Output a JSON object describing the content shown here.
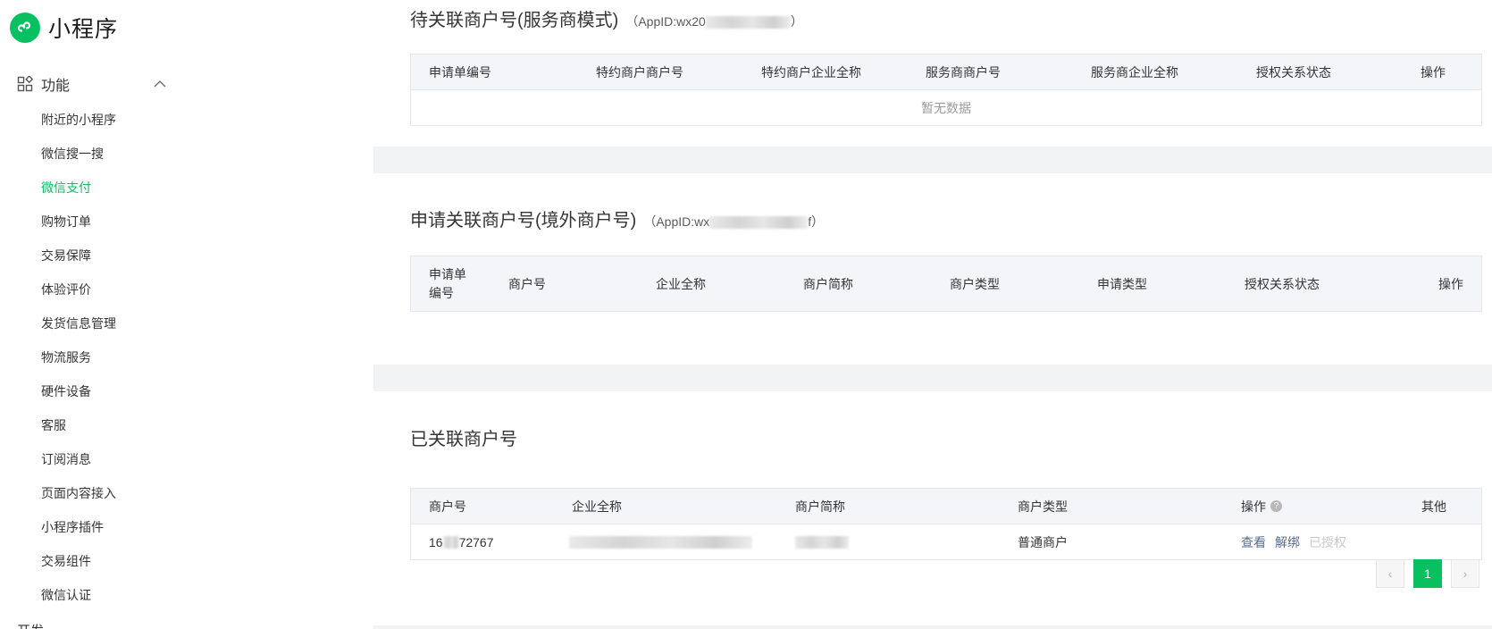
{
  "app": {
    "title": "小程序"
  },
  "nav": {
    "group_label": "功能",
    "items": [
      {
        "label": "附近的小程序",
        "active": false
      },
      {
        "label": "微信搜一搜",
        "active": false
      },
      {
        "label": "微信支付",
        "active": true
      },
      {
        "label": "购物订单",
        "active": false
      },
      {
        "label": "交易保障",
        "active": false
      },
      {
        "label": "体验评价",
        "active": false
      },
      {
        "label": "发货信息管理",
        "active": false
      },
      {
        "label": "物流服务",
        "active": false
      },
      {
        "label": "硬件设备",
        "active": false
      },
      {
        "label": "客服",
        "active": false
      },
      {
        "label": "订阅消息",
        "active": false
      },
      {
        "label": "页面内容接入",
        "active": false
      },
      {
        "label": "小程序插件",
        "active": false
      },
      {
        "label": "交易组件",
        "active": false
      },
      {
        "label": "微信认证",
        "active": false
      }
    ],
    "partial_label": "开发"
  },
  "section1": {
    "title": "待关联商户号(服务商模式)",
    "appid_prefix": "（AppID:wx20",
    "appid_suffix": "）",
    "columns": [
      "申请单编号",
      "特约商户商户号",
      "特约商户企业全称",
      "服务商商户号",
      "服务商企业全称",
      "授权关系状态",
      "操作"
    ],
    "empty_text": "暂无数据"
  },
  "section2": {
    "title": "申请关联商户号(境外商户号)",
    "appid_prefix": "（AppID:wx",
    "appid_suffix": "f）",
    "columns": [
      "申请单编号",
      "商户号",
      "企业全称",
      "商户简称",
      "商户类型",
      "申请类型",
      "授权关系状态",
      "操作"
    ]
  },
  "section3": {
    "title": "已关联商户号",
    "columns": [
      "商户号",
      "企业全称",
      "商户简称",
      "商户类型",
      "操作",
      "其他"
    ],
    "rows": [
      {
        "merchant_id_prefix": "16",
        "merchant_id_suffix": "72767",
        "merchant_type": "普通商户",
        "actions": [
          "查看",
          "解绑",
          "已授权"
        ]
      }
    ],
    "pagination": {
      "current": "1"
    }
  },
  "colors": {
    "accent": "#07c160",
    "link": "#576b95"
  }
}
